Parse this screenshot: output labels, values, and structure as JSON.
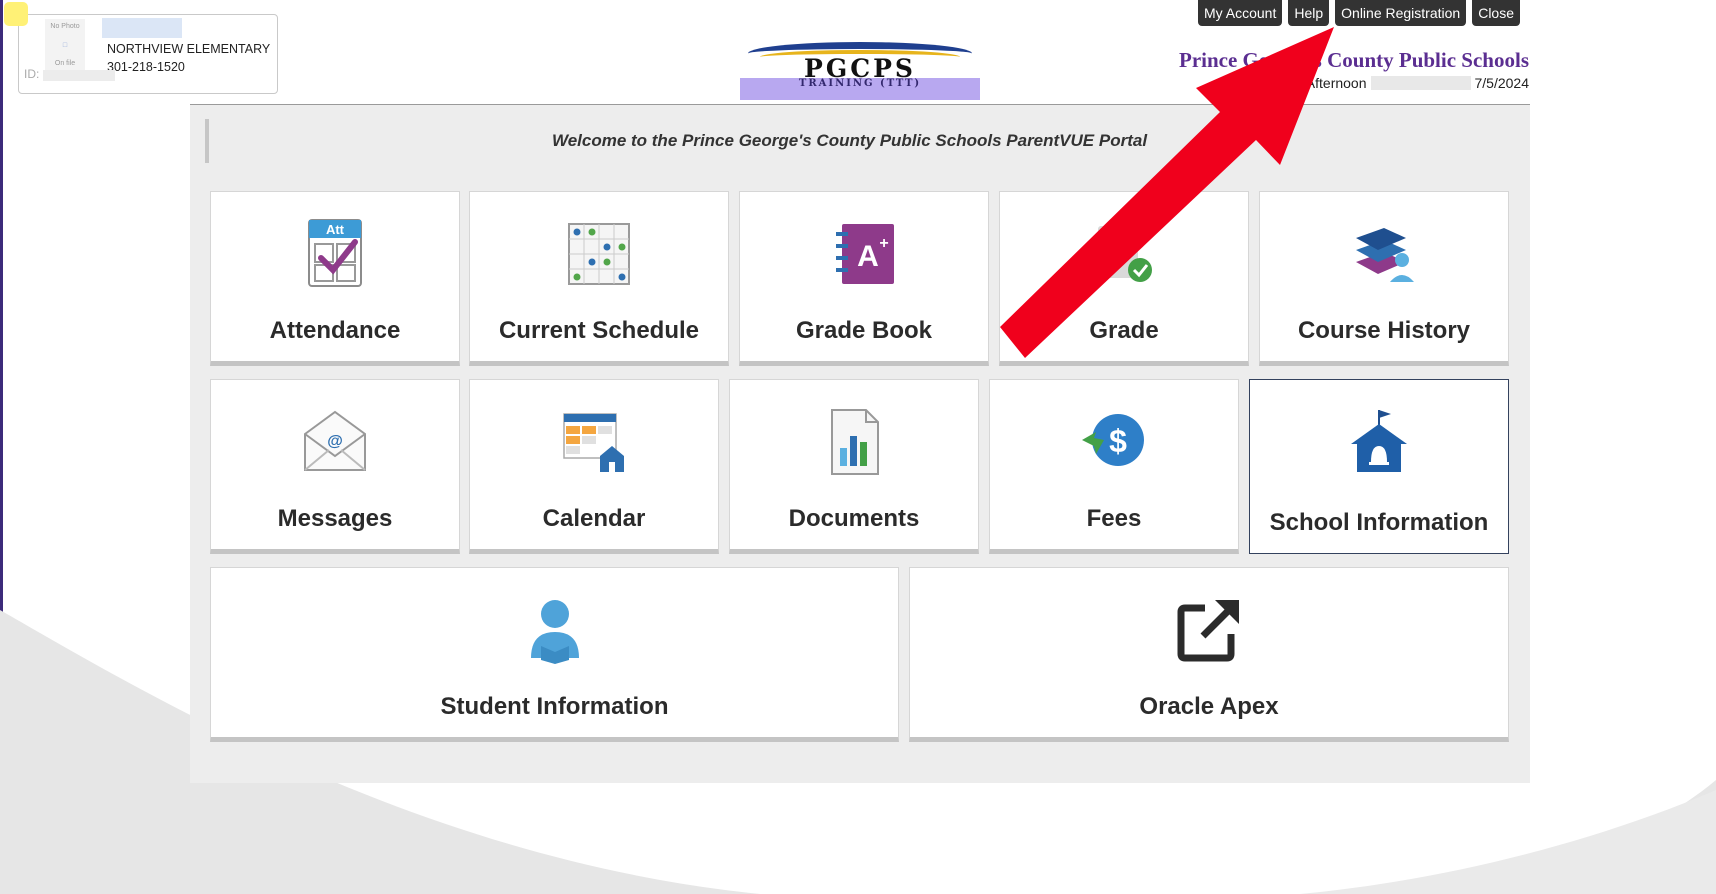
{
  "student_card": {
    "photo_top": "No Photo",
    "photo_bottom": "On file",
    "school": "NORTHVIEW ELEMENTARY",
    "phone": "301-218-1520",
    "id_label": "ID:"
  },
  "logo": {
    "text": "PGCPS",
    "subtext": "TRAINING (TTT)"
  },
  "nav": {
    "my_account": "My Account",
    "help": "Help",
    "online_registration": "Online Registration",
    "close": "Close"
  },
  "header": {
    "district": "Prince George's County Public Schools",
    "greeting_prefix": "Good Afternoon",
    "date": "7/5/2024"
  },
  "welcome": "Welcome to the Prince George's County Public Schools ParentVUE Portal",
  "tiles": [
    {
      "label": "Attendance",
      "icon": "attendance-icon"
    },
    {
      "label": "Current Schedule",
      "icon": "schedule-icon"
    },
    {
      "label": "Grade Book",
      "icon": "gradebook-icon"
    },
    {
      "label": "Grade",
      "icon": "grade-icon"
    },
    {
      "label": "Course History",
      "icon": "course-history-icon"
    },
    {
      "label": "Messages",
      "icon": "messages-icon"
    },
    {
      "label": "Calendar",
      "icon": "calendar-icon"
    },
    {
      "label": "Documents",
      "icon": "documents-icon"
    },
    {
      "label": "Fees",
      "icon": "fees-icon"
    },
    {
      "label": "School Information",
      "icon": "school-info-icon"
    },
    {
      "label": "Student Information",
      "icon": "student-info-icon"
    },
    {
      "label": "Oracle Apex",
      "icon": "external-link-icon"
    }
  ],
  "colors": {
    "district_purple": "#5b2e91",
    "nav_dark": "#333333",
    "arrow_red": "#f0001c",
    "icon_blue": "#2e6fb0"
  }
}
